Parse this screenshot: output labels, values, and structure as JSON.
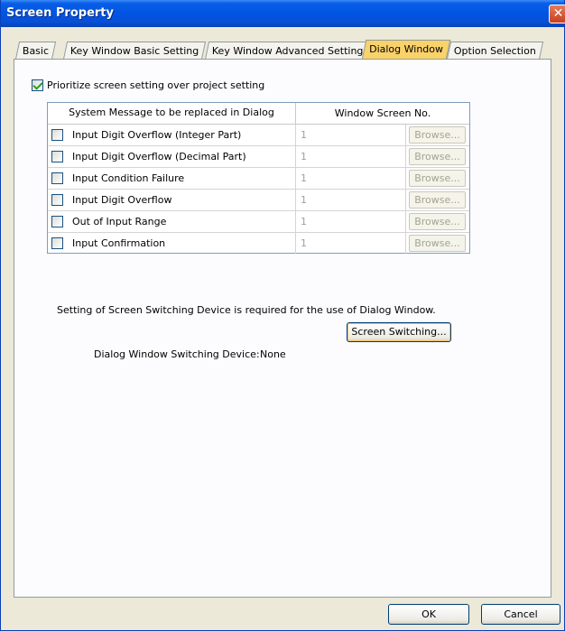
{
  "window": {
    "title": "Screen Property",
    "close_glyph": "✕"
  },
  "tabs": [
    {
      "label": "Basic",
      "active": false
    },
    {
      "label": "Key Window Basic Setting",
      "active": false
    },
    {
      "label": "Key Window Advanced Setting",
      "active": false
    },
    {
      "label": "Dialog Window",
      "active": true
    },
    {
      "label": "Option Selection",
      "active": false
    }
  ],
  "prioritize": {
    "label": "Prioritize screen setting over project setting",
    "checked": true
  },
  "grid": {
    "headers": [
      "System Message to be replaced in Dialog",
      "Window Screen No."
    ],
    "rows": [
      {
        "message": "Input Digit Overflow (Integer Part)",
        "screen_no": "1",
        "browse": "Browse...",
        "checked": false
      },
      {
        "message": "Input Digit Overflow (Decimal Part)",
        "screen_no": "1",
        "browse": "Browse...",
        "checked": false
      },
      {
        "message": "Input Condition Failure",
        "screen_no": "1",
        "browse": "Browse...",
        "checked": false
      },
      {
        "message": "Input Digit Overflow",
        "screen_no": "1",
        "browse": "Browse...",
        "checked": false
      },
      {
        "message": "Out of Input Range",
        "screen_no": "1",
        "browse": "Browse...",
        "checked": false
      },
      {
        "message": "Input Confirmation",
        "screen_no": "1",
        "browse": "Browse...",
        "checked": false
      }
    ]
  },
  "note": "Setting of Screen Switching Device is required for the use of Dialog Window.",
  "screen_switching_button": "Screen Switching...",
  "device": {
    "label": "Dialog Window Switching Device:",
    "value": "None"
  },
  "footer": {
    "ok": "OK",
    "cancel": "Cancel"
  }
}
